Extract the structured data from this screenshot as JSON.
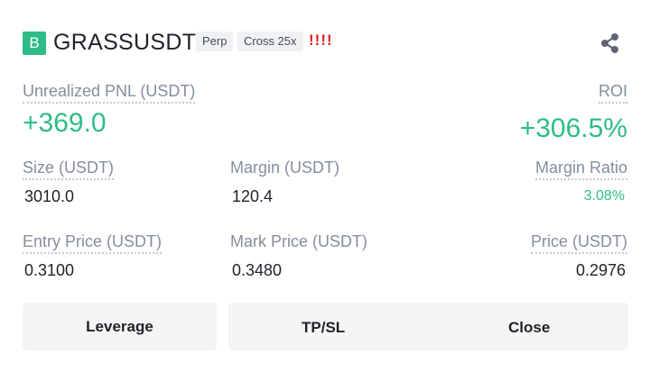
{
  "header": {
    "badge": "B",
    "symbol": "GRASSUSDT",
    "tags": [
      "Perp",
      "Cross 25x"
    ],
    "warning": "!!!!",
    "share_icon": "share-icon"
  },
  "pnl": {
    "label": "Unrealized PNL (USDT)",
    "value": "+369.0"
  },
  "roi": {
    "label": "ROI",
    "value": "+306.5%"
  },
  "size": {
    "label": "Size (USDT)",
    "value": "3010.0"
  },
  "margin": {
    "label": "Margin (USDT)",
    "value": "120.4"
  },
  "margin_ratio": {
    "label": "Margin Ratio",
    "value": "3.08%"
  },
  "entry_price": {
    "label": "Entry Price (USDT)",
    "value": "0.3100"
  },
  "mark_price": {
    "label": "Mark Price (USDT)",
    "value": "0.3480"
  },
  "price": {
    "label": "Price (USDT)",
    "value": "0.2976"
  },
  "buttons": {
    "leverage": "Leverage",
    "tpsl": "TP/SL",
    "close": "Close"
  },
  "colors": {
    "positive": "#2ebd85",
    "badge": "#2ebd85",
    "warning": "#e02020"
  }
}
